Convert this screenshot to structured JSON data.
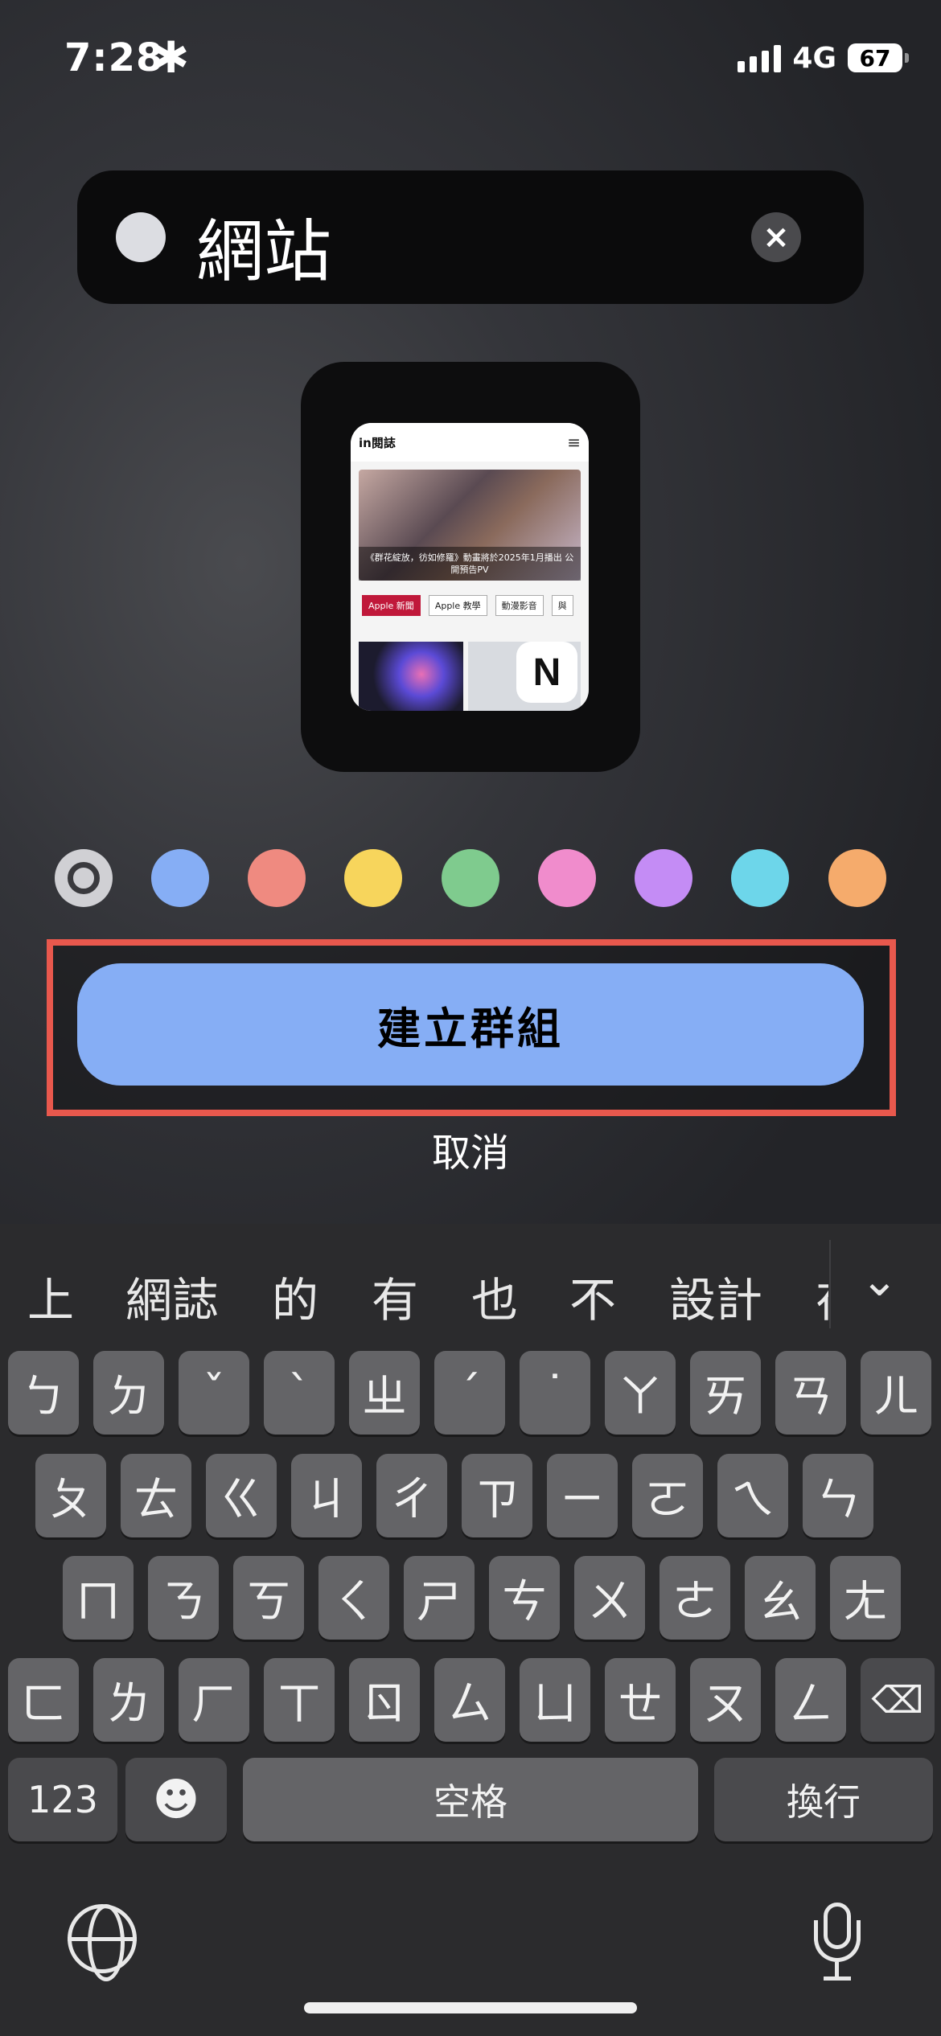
{
  "status_bar": {
    "time": "7:28",
    "focus_glyph": "✱",
    "network": "4G",
    "battery": "67"
  },
  "group_name": {
    "value": "網站",
    "clear_icon": "×"
  },
  "preview": {
    "site_logo": "in閱誌",
    "menu_icon": "≡",
    "hero_caption": "《群花綻放，彷如修羅》動畫將於2025年1月播出 公開預告PV",
    "tags": [
      "Apple 新聞",
      "Apple 教學",
      "動漫影音",
      "與"
    ],
    "app_icon_letter": "N"
  },
  "colors": {
    "swatches": [
      "#d0d0d4",
      "#86aef5",
      "#ef8a80",
      "#f7d55c",
      "#7fcb8e",
      "#f08ccc",
      "#c48cf5",
      "#6dd6ea",
      "#f5ab6c"
    ],
    "selected_index": 0,
    "highlight_border": "#e8584d",
    "create_button": "#86aef5"
  },
  "actions": {
    "create_group": "建立群組",
    "cancel": "取消"
  },
  "keyboard": {
    "candidates": [
      "上",
      "網誌",
      "的",
      "有",
      "也",
      "不",
      "設計",
      "在"
    ],
    "collapse_icon": "chevron-down-icon",
    "row1": [
      "ㄅ",
      "ㄉ",
      "ˇ",
      "ˋ",
      "ㄓ",
      "ˊ",
      "˙",
      "ㄚ",
      "ㄞ",
      "ㄢ",
      "ㄦ"
    ],
    "row2": [
      "ㄆ",
      "ㄊ",
      "ㄍ",
      "ㄐ",
      "ㄔ",
      "ㄗ",
      "ㄧ",
      "ㄛ",
      "ㄟ",
      "ㄣ"
    ],
    "row3": [
      "ㄇ",
      "ㄋ",
      "ㄎ",
      "ㄑ",
      "ㄕ",
      "ㄘ",
      "ㄨ",
      "ㄜ",
      "ㄠ",
      "ㄤ"
    ],
    "row4": [
      "ㄈ",
      "ㄌ",
      "ㄏ",
      "ㄒ",
      "ㄖ",
      "ㄙ",
      "ㄩ",
      "ㄝ",
      "ㄡ",
      "ㄥ"
    ],
    "backspace_icon": "⌫",
    "numbers": "123",
    "emoji_icon": "☻",
    "space": "空格",
    "return": "換行"
  }
}
